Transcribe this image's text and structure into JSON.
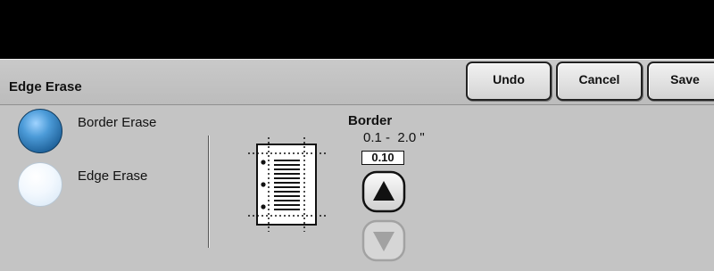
{
  "header": {
    "title": "Edge Erase",
    "buttons": {
      "undo": "Undo",
      "cancel": "Cancel",
      "save": "Save"
    }
  },
  "options": [
    {
      "label": "Border Erase",
      "selected": true
    },
    {
      "label": "Edge Erase",
      "selected": false
    }
  ],
  "border": {
    "title": "Border",
    "range": "0.1 -  2.0 \"",
    "value": "0.10",
    "up_icon": "up-arrow-icon",
    "down_icon": "down-arrow-icon",
    "down_enabled": false
  },
  "colors": {
    "top_bar": "#000000",
    "background": "#c4c4c4",
    "radio_selected": "#2f7cc0"
  }
}
